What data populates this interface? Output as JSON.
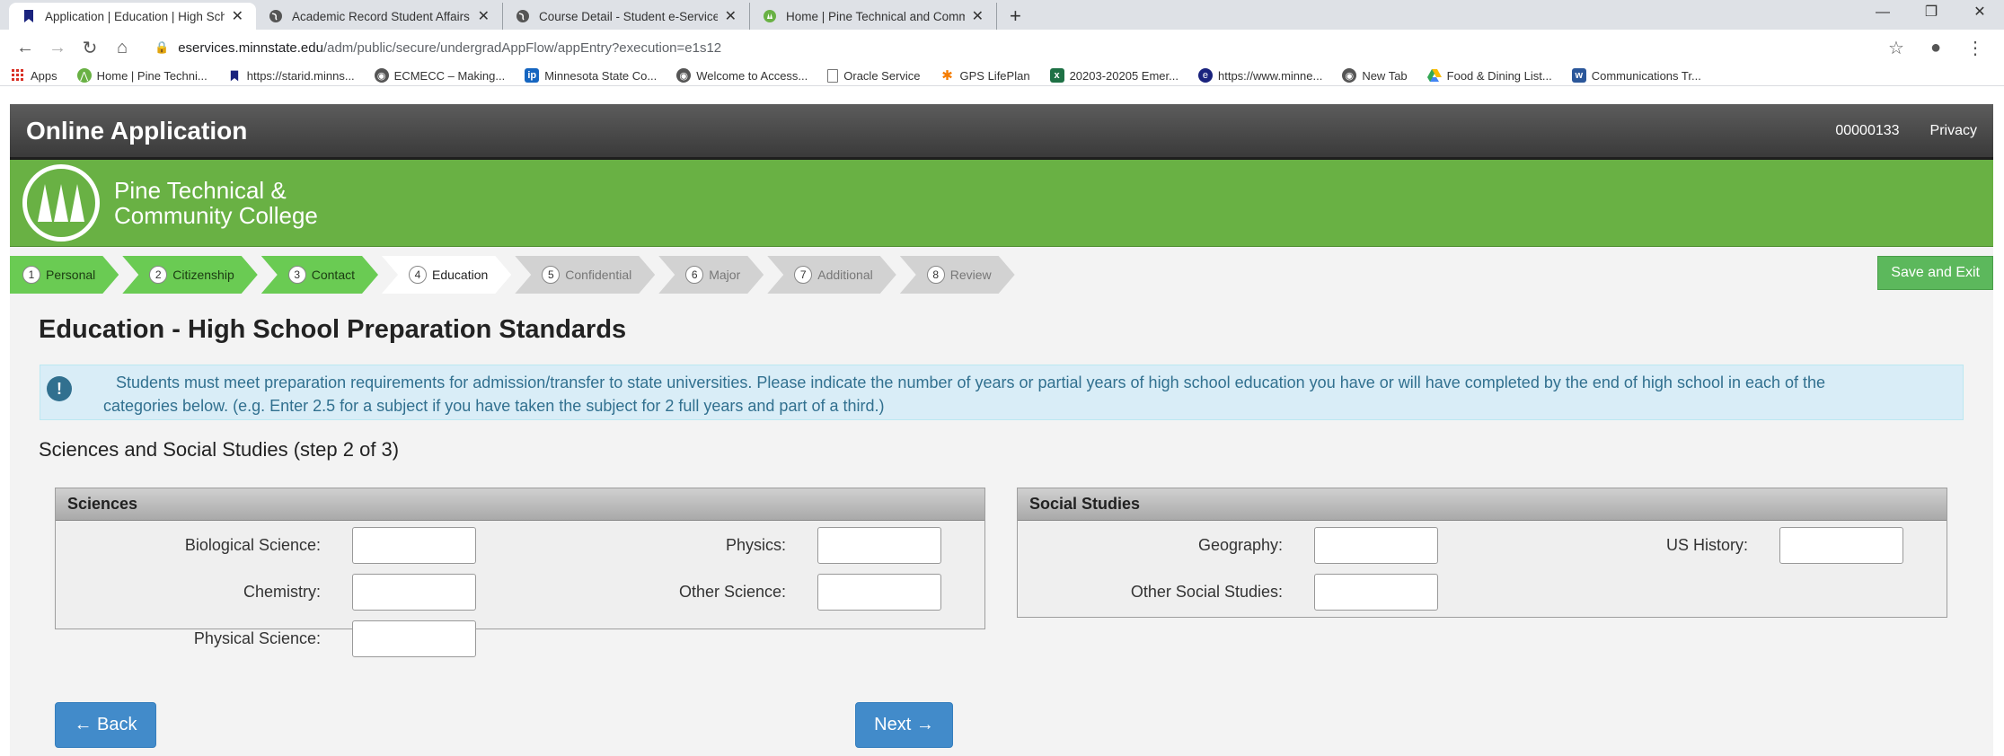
{
  "browser": {
    "tabs": [
      {
        "label": "Application | Education | High School",
        "active": true
      },
      {
        "label": "Academic Record Student Affairs",
        "active": false
      },
      {
        "label": "Course Detail - Student e-Services",
        "active": false
      },
      {
        "label": "Home | Pine Technical and Community",
        "active": false
      }
    ],
    "new_tab": "+",
    "url_host": "eservices.minnstate.edu",
    "url_path": "/adm/public/secure/undergradAppFlow/appEntry?execution=e1s12",
    "bookmarks": [
      "Apps",
      "Home | Pine Techni...",
      "https://starid.minns...",
      "ECMECC – Making...",
      "Minnesota State Co...",
      "Welcome to Access...",
      "Oracle Service",
      "GPS LifePlan",
      "20203-20205 Emer...",
      "https://www.minne...",
      "New Tab",
      "Food & Dining List...",
      "Communications Tr..."
    ]
  },
  "header": {
    "title": "Online Application",
    "id_number": "00000133",
    "privacy": "Privacy"
  },
  "brand": {
    "name_line1": "Pine Technical &",
    "name_line2": "Community College"
  },
  "steps": [
    {
      "num": "1",
      "label": "Personal",
      "state": "done"
    },
    {
      "num": "2",
      "label": "Citizenship",
      "state": "done"
    },
    {
      "num": "3",
      "label": "Contact",
      "state": "done"
    },
    {
      "num": "4",
      "label": "Education",
      "state": "current"
    },
    {
      "num": "5",
      "label": "Confidential",
      "state": "todo"
    },
    {
      "num": "6",
      "label": "Major",
      "state": "todo"
    },
    {
      "num": "7",
      "label": "Additional",
      "state": "todo"
    },
    {
      "num": "8",
      "label": "Review",
      "state": "todo"
    }
  ],
  "save_exit": "Save and Exit",
  "page_title": "Education - High School Preparation Standards",
  "alert": {
    "line1": "Students must meet preparation requirements for admission/transfer to state universities. Please indicate the number of years or partial years of high school education you have or will have completed by the end of high school in each of the",
    "line2": "categories below. (e.g. Enter 2.5 for a subject if you have taken the subject for 2 full years and part of a third.)"
  },
  "section_heading": "Sciences and Social Studies (step 2 of 3)",
  "sciences": {
    "title": "Sciences",
    "fields": {
      "biological": {
        "label": "Biological Science:",
        "value": ""
      },
      "physics": {
        "label": "Physics:",
        "value": ""
      },
      "chemistry": {
        "label": "Chemistry:",
        "value": ""
      },
      "other": {
        "label": "Other Science:",
        "value": ""
      },
      "physical": {
        "label": "Physical Science:",
        "value": ""
      }
    }
  },
  "social": {
    "title": "Social Studies",
    "fields": {
      "geography": {
        "label": "Geography:",
        "value": ""
      },
      "us_history": {
        "label": "US History:",
        "value": ""
      },
      "other": {
        "label": "Other Social Studies:",
        "value": ""
      }
    }
  },
  "buttons": {
    "back": "← Back",
    "next": "Next →"
  },
  "colors": {
    "header_bg": "#4a4a4a",
    "brand_green": "#69b144",
    "step_done": "#6acb53",
    "button_blue": "#428bca",
    "alert_bg": "#d9edf7"
  }
}
